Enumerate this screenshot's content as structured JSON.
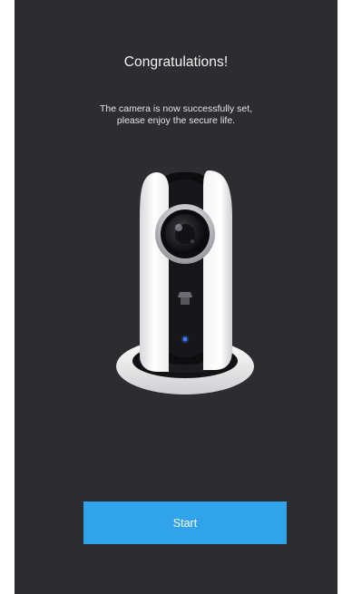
{
  "screen": {
    "title": "Congratulations!",
    "message_line1": "The camera is now successfully set,",
    "message_line2": "please enjoy the secure life.",
    "camera_image": "security-camera-image",
    "start_label": "Start"
  },
  "colors": {
    "background": "#2d2c31",
    "button": "#30a3ea",
    "text": "#ffffff"
  }
}
